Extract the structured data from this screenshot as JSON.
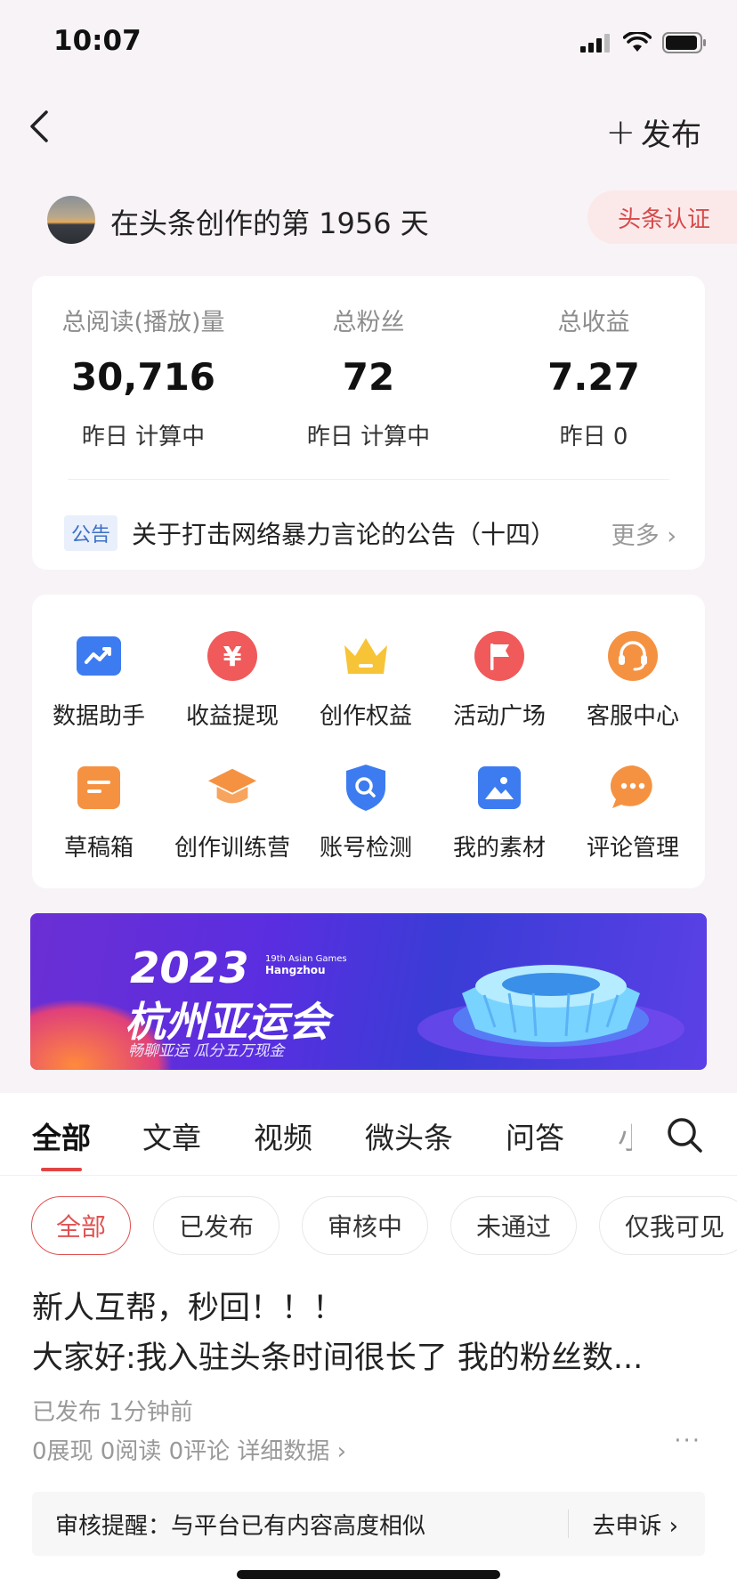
{
  "status_bar": {
    "time": "10:07",
    "wifi_icon": "wifi-icon",
    "battery_icon": "battery-icon",
    "signal_icon": "signal-icon"
  },
  "nav": {
    "publish_plus": "+",
    "publish_label": "发布"
  },
  "profile": {
    "creation_text": "在头条创作的第 1956 天",
    "cert_label": "头条认证"
  },
  "stats": [
    {
      "label": "总阅读(播放)量",
      "value": "30,716",
      "sub": "昨日 计算中"
    },
    {
      "label": "总粉丝",
      "value": "72",
      "sub": "昨日 计算中"
    },
    {
      "label": "总收益",
      "value": "7.27",
      "sub": "昨日 0"
    }
  ],
  "notice": {
    "tag": "公告",
    "text": "关于打击网络暴力言论的公告（十四）",
    "more": "更多 ›"
  },
  "tools": [
    {
      "label": "数据助手",
      "icon": "chart-icon",
      "color": "#3d7cf0"
    },
    {
      "label": "收益提现",
      "icon": "yuan-icon",
      "color": "#f05a5a"
    },
    {
      "label": "创作权益",
      "icon": "crown-icon",
      "color": "#f7c437"
    },
    {
      "label": "活动广场",
      "icon": "flag-icon",
      "color": "#f05a5a"
    },
    {
      "label": "客服中心",
      "icon": "headset-icon",
      "color": "#f59242"
    },
    {
      "label": "草稿箱",
      "icon": "draft-icon",
      "color": "#f59242"
    },
    {
      "label": "创作训练营",
      "icon": "graduation-cap-icon",
      "color": "#f59242"
    },
    {
      "label": "账号检测",
      "icon": "shield-search-icon",
      "color": "#3d7cf0"
    },
    {
      "label": "我的素材",
      "icon": "image-icon",
      "color": "#3d7cf0"
    },
    {
      "label": "评论管理",
      "icon": "comment-icon",
      "color": "#f59242"
    }
  ],
  "banner": {
    "year": "2023",
    "city": "杭州亚运会",
    "slogan": "畅聊亚运  瓜分五万现金",
    "games_line1": "19th Asian Games",
    "games_line2": "Hangzhou"
  },
  "content_tabs": [
    "全部",
    "文章",
    "视频",
    "微头条",
    "问答",
    "小"
  ],
  "filters": [
    "全部",
    "已发布",
    "审核中",
    "未通过",
    "仅我可见"
  ],
  "post": {
    "title_line1": "新人互帮，秒回！！！",
    "title_line2": "大家好:我入驻头条时间很长了 我的粉丝数...",
    "status": "已发布   1分钟前",
    "metrics": "0展现   0阅读   0评论   详细数据 ›",
    "more": "···"
  },
  "review": {
    "text": "审核提醒：与平台已有内容高度相似",
    "action": "去申诉 ›"
  }
}
